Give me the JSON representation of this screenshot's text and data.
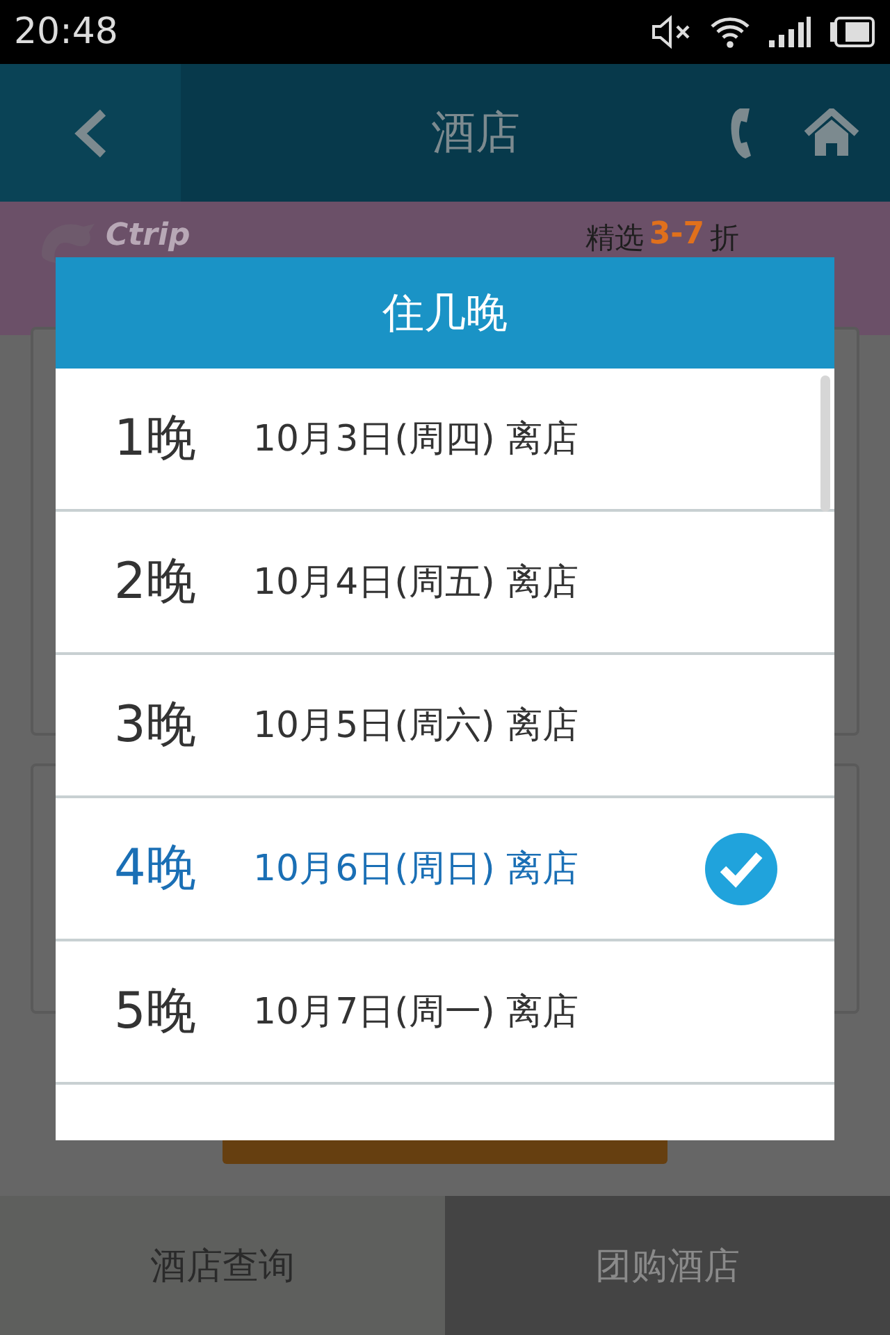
{
  "status_bar": {
    "time": "20:48"
  },
  "header": {
    "title": "酒店"
  },
  "banner": {
    "logo": "Ctrip",
    "sub_prefix": "精选",
    "discount": "3-7",
    "sub_suffix": "折"
  },
  "bottom_tabs": [
    {
      "label": "酒店查询",
      "selected": true
    },
    {
      "label": "团购酒店",
      "selected": false
    }
  ],
  "dialog": {
    "title": "住几晚",
    "options": [
      {
        "nights": "1晚",
        "checkout": "10月3日(周四) 离店",
        "selected": false
      },
      {
        "nights": "2晚",
        "checkout": "10月4日(周五) 离店",
        "selected": false
      },
      {
        "nights": "3晚",
        "checkout": "10月5日(周六) 离店",
        "selected": false
      },
      {
        "nights": "4晚",
        "checkout": "10月6日(周日) 离店",
        "selected": true
      },
      {
        "nights": "5晚",
        "checkout": "10月7日(周一) 离店",
        "selected": false
      }
    ]
  }
}
